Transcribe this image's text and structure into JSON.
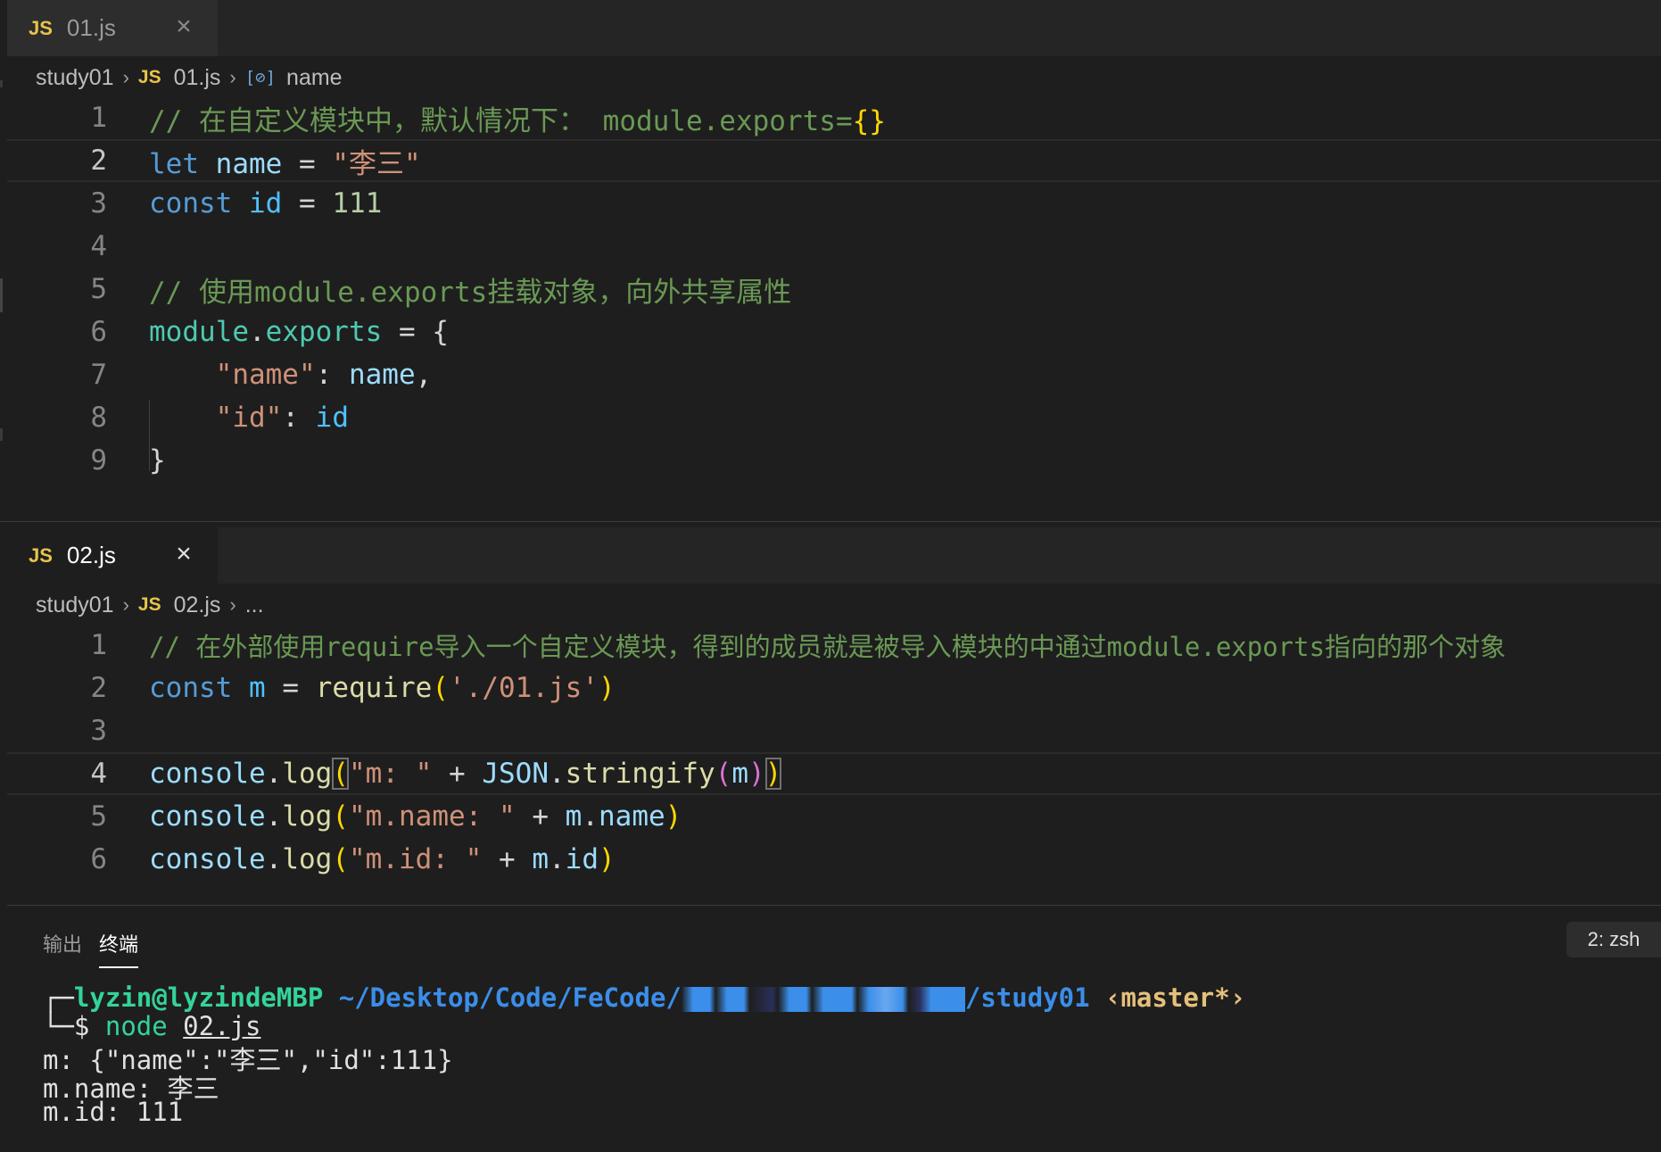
{
  "editor1": {
    "tab": {
      "icon": "JS",
      "label": "01.js",
      "close": "×"
    },
    "breadcrumb": {
      "folder": "study01",
      "icon": "JS",
      "file": "01.js",
      "symbol_icon": "[⊘]",
      "symbol": "name"
    },
    "line_numbers": [
      "1",
      "2",
      "3",
      "4",
      "5",
      "6",
      "7",
      "8",
      "9"
    ],
    "current_line": 2
  },
  "editor2": {
    "tab": {
      "icon": "JS",
      "label": "02.js",
      "close": "×"
    },
    "breadcrumb": {
      "folder": "study01",
      "icon": "JS",
      "file": "02.js",
      "more": "..."
    },
    "line_numbers": [
      "1",
      "2",
      "3",
      "4",
      "5",
      "6"
    ],
    "current_line": 4
  },
  "code1": {
    "l1_comment": "// 在自定义模块中，默认情况下： module.exports=",
    "l1_braces": "{}",
    "l2_kw": "let",
    "l2_var": "name",
    "l2_op": "=",
    "l2_str": "\"李三\"",
    "l3_kw": "const",
    "l3_var": "id",
    "l3_op": "=",
    "l3_num": "111",
    "l5_comment": "// 使用module.exports挂载对象，向外共享属性",
    "l6_obj": "module",
    "l6_dot": ".",
    "l6_prop": "exports",
    "l6_op": "=",
    "l6_brace": "{",
    "l7_key": "\"name\"",
    "l7_colon": ":",
    "l7_val": "name",
    "l7_comma": ",",
    "l8_key": "\"id\"",
    "l8_colon": ":",
    "l8_val": "id",
    "l9_brace": "}"
  },
  "code2": {
    "l1_comment": "// 在外部使用require导入一个自定义模块，得到的成员就是被导入模块的中通过module.exports指向的那个对象",
    "l2_kw": "const",
    "l2_var": "m",
    "l2_op": "=",
    "l2_fn": "require",
    "l2_open": "(",
    "l2_str": "'./01.js'",
    "l2_close": ")",
    "l4_obj": "console",
    "l4_dot": ".",
    "l4_fn": "log",
    "l4_open": "(",
    "l4_str": "\"m: \"",
    "l4_plus": "+",
    "l4_json": "JSON",
    "l4_dot2": ".",
    "l4_fn2": "stringify",
    "l4_open2": "(",
    "l4_arg": "m",
    "l4_close2": ")",
    "l4_close": ")",
    "l5_obj": "console",
    "l5_dot": ".",
    "l5_fn": "log",
    "l5_open": "(",
    "l5_str": "\"m.name: \"",
    "l5_plus": "+",
    "l5_m": "m",
    "l5_dot2": ".",
    "l5_prop": "name",
    "l5_close": ")",
    "l6_obj": "console",
    "l6_dot": ".",
    "l6_fn": "log",
    "l6_open": "(",
    "l6_str": "\"m.id: \"",
    "l6_plus": "+",
    "l6_m": "m",
    "l6_dot2": ".",
    "l6_prop": "id",
    "l6_close": ")"
  },
  "panel": {
    "tabs": [
      "输出",
      "终端"
    ],
    "active_tab": "终端",
    "terminal_select": "2: zsh"
  },
  "terminal": {
    "prompt_corner": "┌─",
    "user_host": "lyzin@lyzindeMBP",
    "path_prefix": "~/Desktop/Code/FeCode/",
    "path_suffix": "/study01",
    "branch": "‹master*›",
    "cmd_corner": "└─",
    "dollar": "$",
    "cmd_node": "node",
    "cmd_arg": "02.js",
    "out1": "m: {\"name\":\"李三\",\"id\":111}",
    "out2": "m.name: 李三",
    "out3": "m.id: 111"
  },
  "colors": {
    "comment": "#6a9955",
    "keyword": "#569cd6",
    "variable": "#9cdcfe",
    "string": "#ce9178",
    "number": "#b5cea8",
    "function": "#dcdcaa",
    "js_icon": "#e8c44a",
    "terminal_green": "#34d399",
    "terminal_blue": "#3b8eea"
  }
}
